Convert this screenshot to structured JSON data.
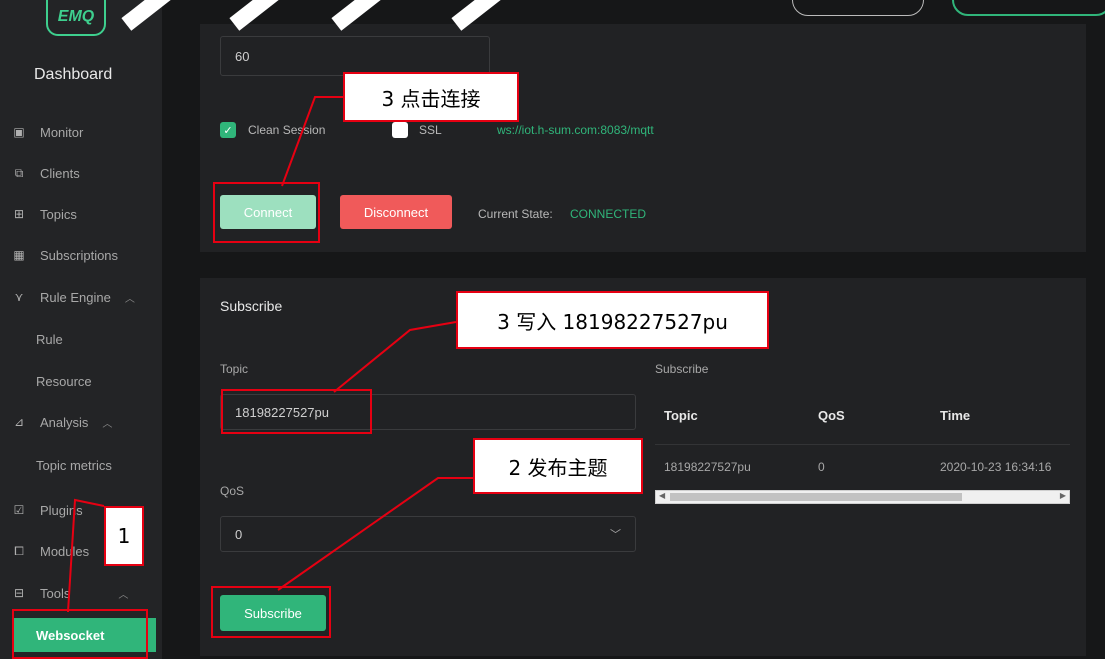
{
  "sidebar": {
    "logo_text": "EMQ",
    "brand": "Dashboard",
    "items": [
      {
        "label": "Monitor",
        "icon": "monitor-icon"
      },
      {
        "label": "Clients",
        "icon": "clients-icon"
      },
      {
        "label": "Topics",
        "icon": "topics-icon"
      },
      {
        "label": "Subscriptions",
        "icon": "subscriptions-icon"
      },
      {
        "label": "Rule Engine",
        "icon": "rule-engine-icon"
      },
      {
        "label": "Analysis",
        "icon": "analysis-icon"
      },
      {
        "label": "Plugins",
        "icon": "plugins-icon"
      },
      {
        "label": "Modules",
        "icon": "modules-icon"
      },
      {
        "label": "Tools",
        "icon": "tools-icon"
      }
    ],
    "sub_rule": "Rule",
    "sub_resource": "Resource",
    "sub_topic_metrics": "Topic metrics",
    "websocket": "Websocket"
  },
  "connection": {
    "keepalive_value": "60",
    "clean_session_label": "Clean Session",
    "ssl_label": "SSL",
    "url": "ws://iot.h-sum.com:8083/mqtt",
    "connect_label": "Connect",
    "disconnect_label": "Disconnect",
    "state_label": "Current State:",
    "state_value": "CONNECTED"
  },
  "subscribe": {
    "title": "Subscribe",
    "topic_label": "Topic",
    "topic_value": "18198227527pu",
    "qos_label": "QoS",
    "qos_value": "0",
    "button_label": "Subscribe",
    "list_title": "Subscribe",
    "columns": [
      "Topic",
      "QoS",
      "Time"
    ],
    "rows": [
      {
        "topic": "18198227527pu",
        "qos": "0",
        "time": "2020-10-23 16:34:16"
      }
    ]
  },
  "annotations": {
    "callout_connect": "3 点击连接",
    "callout_write": "3 写入 18198227527pu",
    "callout_publish": "2 发布主题",
    "callout_one": "1"
  },
  "colors": {
    "accent_green": "#30b57a",
    "disconnect_red": "#f05a5a",
    "annotation_red": "#e60012"
  }
}
